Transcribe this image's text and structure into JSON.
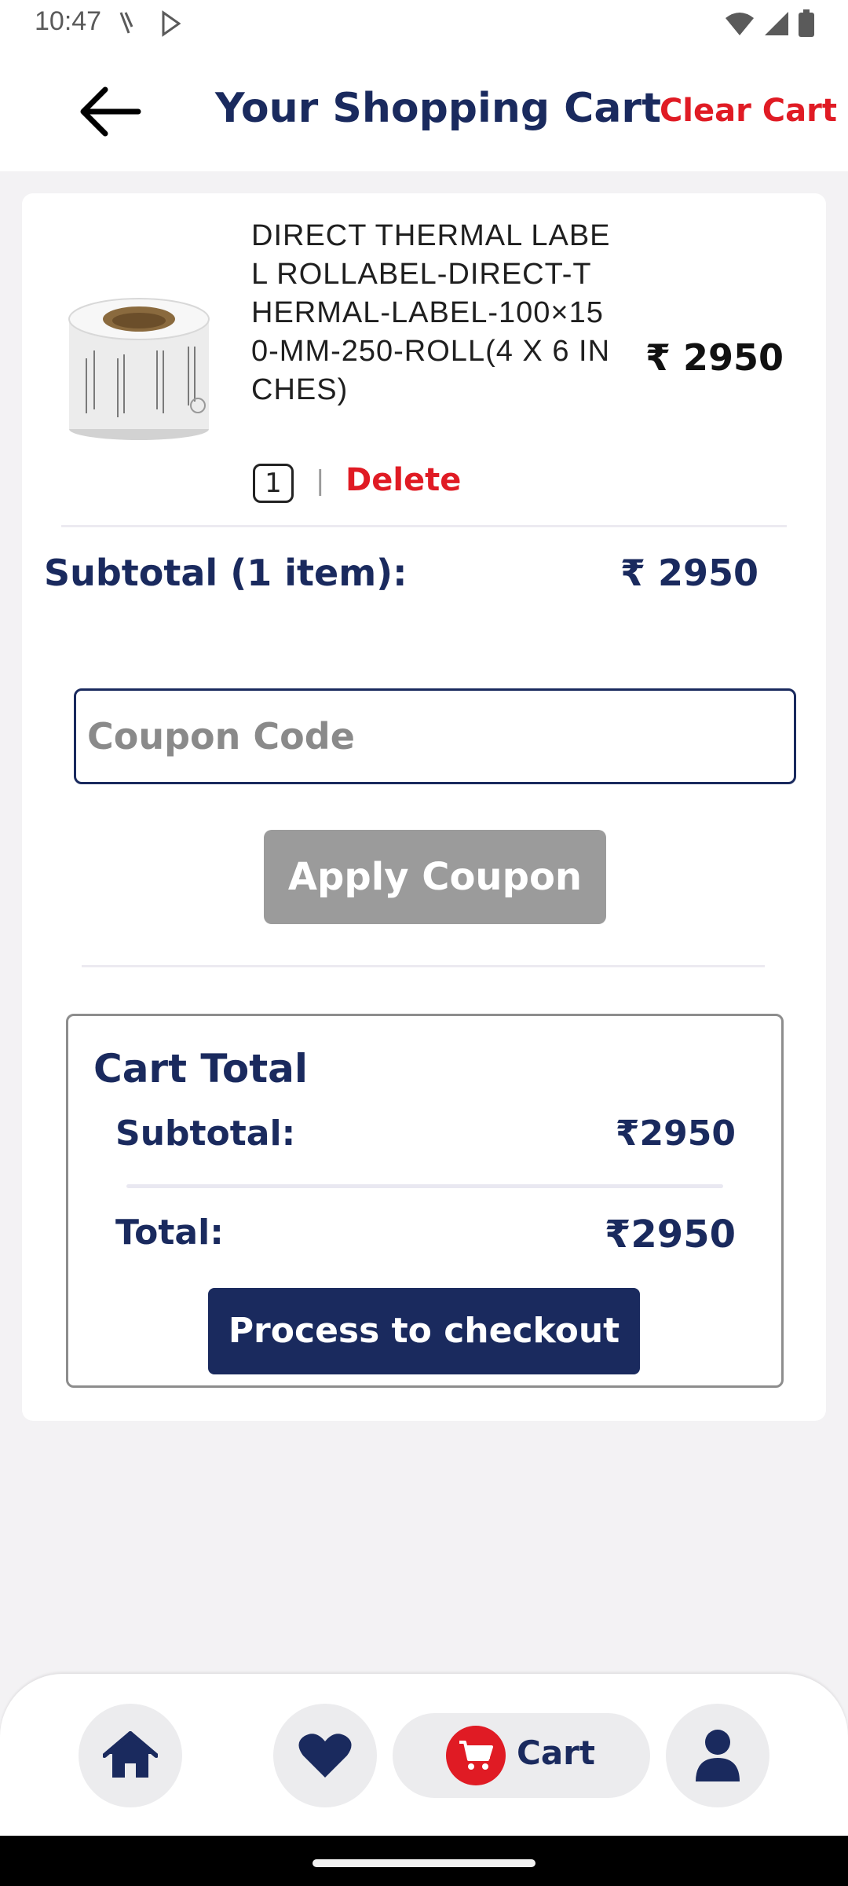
{
  "status_bar": {
    "time": "10:47"
  },
  "header": {
    "title": "Your Shopping Cart",
    "clear_cart": "Clear Cart"
  },
  "cart_items": [
    {
      "name": "DIRECT THERMAL LABEL ROLLABEL-DIRECT-THERMAL-LABEL-100×150-MM-250-ROLL(4 X 6 INCHES)",
      "price": "₹ 2950",
      "quantity": "1",
      "separator": "|",
      "delete_label": "Delete"
    }
  ],
  "subtotal_row": {
    "label": "Subtotal (1 item):",
    "value": "₹ 2950"
  },
  "coupon": {
    "placeholder": "Coupon Code",
    "value": "",
    "apply_label": "Apply Coupon"
  },
  "cart_total": {
    "title": "Cart Total",
    "subtotal_label": "Subtotal:",
    "subtotal_value": "₹2950",
    "total_label": "Total:",
    "total_value": "₹2950",
    "checkout_label": "Process to checkout"
  },
  "bottom_nav": {
    "cart_label": "Cart"
  },
  "colors": {
    "navy": "#1a2a5e",
    "red": "#e01b24",
    "disabled_button": "#9b9b9b",
    "background": "#f3f2f4"
  },
  "icons": [
    "back-arrow-icon",
    "home-icon",
    "heart-icon",
    "cart-icon",
    "person-icon"
  ]
}
